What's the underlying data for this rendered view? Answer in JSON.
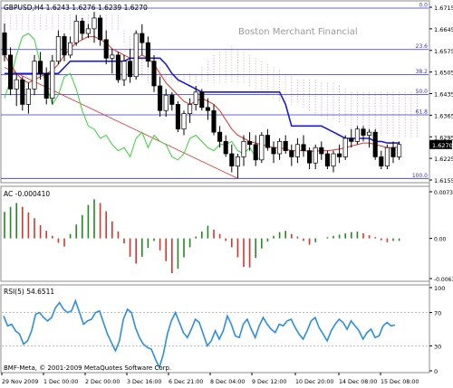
{
  "chart_data": [
    {
      "type": "candlestick",
      "title": "GBPUSD,H4  1.6243 1.6276 1.6239 1.6270",
      "watermark": "Boston Merchant Financial",
      "ylim": [
        1.6155,
        1.6715
      ],
      "y_ticks": [
        "1.6715",
        "1.6645",
        "1.6575",
        "1.6505",
        "1.6435",
        "1.6365",
        "1.6295",
        "1.6225",
        "1.6155"
      ],
      "last_price": "1.6270",
      "fib_levels": [
        {
          "label": "0.0",
          "value": 1.6712
        },
        {
          "label": "23.6",
          "value": 1.6578
        },
        {
          "label": "38.2",
          "value": 1.6497
        },
        {
          "label": "50.0",
          "value": 1.6432
        },
        {
          "label": "61.8",
          "value": 1.6366
        },
        {
          "label": "100.0",
          "value": 1.616
        }
      ],
      "colors": {
        "bull": "#ffffff",
        "bear": "#000000",
        "tenkan": "#e0302a",
        "kijun": "#1a1ad8",
        "chikou": "#37d437",
        "cloud": "#c8a0c8",
        "cloud_bull": "#e8b090",
        "fib": "#3333cc",
        "trend": "#e0302a",
        "frame": "#8c8c8c"
      },
      "candles": [
        {
          "o": 1.6632,
          "h": 1.6662,
          "l": 1.654,
          "c": 1.656
        },
        {
          "o": 1.656,
          "h": 1.6585,
          "l": 1.643,
          "c": 1.645
        },
        {
          "o": 1.645,
          "h": 1.65,
          "l": 1.6395,
          "c": 1.648
        },
        {
          "o": 1.648,
          "h": 1.649,
          "l": 1.638,
          "c": 1.64
        },
        {
          "o": 1.64,
          "h": 1.647,
          "l": 1.637,
          "c": 1.645
        },
        {
          "o": 1.645,
          "h": 1.656,
          "l": 1.643,
          "c": 1.654
        },
        {
          "o": 1.654,
          "h": 1.657,
          "l": 1.648,
          "c": 1.65
        },
        {
          "o": 1.65,
          "h": 1.652,
          "l": 1.64,
          "c": 1.642
        },
        {
          "o": 1.642,
          "h": 1.656,
          "l": 1.64,
          "c": 1.654
        },
        {
          "o": 1.654,
          "h": 1.664,
          "l": 1.653,
          "c": 1.662
        },
        {
          "o": 1.662,
          "h": 1.663,
          "l": 1.654,
          "c": 1.656
        },
        {
          "o": 1.656,
          "h": 1.662,
          "l": 1.655,
          "c": 1.66
        },
        {
          "o": 1.66,
          "h": 1.669,
          "l": 1.659,
          "c": 1.667
        },
        {
          "o": 1.667,
          "h": 1.668,
          "l": 1.661,
          "c": 1.663
        },
        {
          "o": 1.663,
          "h": 1.666,
          "l": 1.6615,
          "c": 1.6645
        },
        {
          "o": 1.6645,
          "h": 1.67,
          "l": 1.66,
          "c": 1.668
        },
        {
          "o": 1.668,
          "h": 1.669,
          "l": 1.659,
          "c": 1.661
        },
        {
          "o": 1.661,
          "h": 1.664,
          "l": 1.653,
          "c": 1.655
        },
        {
          "o": 1.655,
          "h": 1.658,
          "l": 1.65,
          "c": 1.656
        },
        {
          "o": 1.656,
          "h": 1.657,
          "l": 1.647,
          "c": 1.648
        },
        {
          "o": 1.648,
          "h": 1.656,
          "l": 1.646,
          "c": 1.654
        },
        {
          "o": 1.654,
          "h": 1.658,
          "l": 1.647,
          "c": 1.649
        },
        {
          "o": 1.649,
          "h": 1.664,
          "l": 1.648,
          "c": 1.663
        },
        {
          "o": 1.663,
          "h": 1.666,
          "l": 1.656,
          "c": 1.66
        },
        {
          "o": 1.66,
          "h": 1.662,
          "l": 1.652,
          "c": 1.654
        },
        {
          "o": 1.654,
          "h": 1.656,
          "l": 1.644,
          "c": 1.646
        },
        {
          "o": 1.646,
          "h": 1.649,
          "l": 1.636,
          "c": 1.638
        },
        {
          "o": 1.638,
          "h": 1.645,
          "l": 1.636,
          "c": 1.643
        },
        {
          "o": 1.643,
          "h": 1.644,
          "l": 1.638,
          "c": 1.64
        },
        {
          "o": 1.64,
          "h": 1.641,
          "l": 1.631,
          "c": 1.632
        },
        {
          "o": 1.632,
          "h": 1.638,
          "l": 1.63,
          "c": 1.637
        },
        {
          "o": 1.637,
          "h": 1.642,
          "l": 1.634,
          "c": 1.64
        },
        {
          "o": 1.64,
          "h": 1.646,
          "l": 1.638,
          "c": 1.644
        },
        {
          "o": 1.644,
          "h": 1.645,
          "l": 1.638,
          "c": 1.639
        },
        {
          "o": 1.639,
          "h": 1.642,
          "l": 1.635,
          "c": 1.638
        },
        {
          "o": 1.638,
          "h": 1.64,
          "l": 1.63,
          "c": 1.631
        },
        {
          "o": 1.631,
          "h": 1.633,
          "l": 1.626,
          "c": 1.628
        },
        {
          "o": 1.628,
          "h": 1.63,
          "l": 1.623,
          "c": 1.624
        },
        {
          "o": 1.624,
          "h": 1.627,
          "l": 1.618,
          "c": 1.62
        },
        {
          "o": 1.62,
          "h": 1.624,
          "l": 1.616,
          "c": 1.623
        },
        {
          "o": 1.623,
          "h": 1.63,
          "l": 1.62,
          "c": 1.628
        },
        {
          "o": 1.628,
          "h": 1.631,
          "l": 1.625,
          "c": 1.627
        },
        {
          "o": 1.627,
          "h": 1.63,
          "l": 1.62,
          "c": 1.622
        },
        {
          "o": 1.622,
          "h": 1.631,
          "l": 1.621,
          "c": 1.63
        },
        {
          "o": 1.63,
          "h": 1.632,
          "l": 1.625,
          "c": 1.626
        },
        {
          "o": 1.626,
          "h": 1.628,
          "l": 1.621,
          "c": 1.624
        },
        {
          "o": 1.624,
          "h": 1.629,
          "l": 1.622,
          "c": 1.628
        },
        {
          "o": 1.628,
          "h": 1.63,
          "l": 1.624,
          "c": 1.625
        },
        {
          "o": 1.625,
          "h": 1.627,
          "l": 1.62,
          "c": 1.623
        },
        {
          "o": 1.623,
          "h": 1.629,
          "l": 1.621,
          "c": 1.627
        },
        {
          "o": 1.627,
          "h": 1.63,
          "l": 1.623,
          "c": 1.625
        },
        {
          "o": 1.625,
          "h": 1.626,
          "l": 1.619,
          "c": 1.621
        },
        {
          "o": 1.621,
          "h": 1.627,
          "l": 1.619,
          "c": 1.626
        },
        {
          "o": 1.626,
          "h": 1.628,
          "l": 1.622,
          "c": 1.624
        },
        {
          "o": 1.624,
          "h": 1.625,
          "l": 1.619,
          "c": 1.62
        },
        {
          "o": 1.62,
          "h": 1.625,
          "l": 1.618,
          "c": 1.624
        },
        {
          "o": 1.624,
          "h": 1.627,
          "l": 1.621,
          "c": 1.623
        },
        {
          "o": 1.623,
          "h": 1.63,
          "l": 1.622,
          "c": 1.629
        },
        {
          "o": 1.629,
          "h": 1.632,
          "l": 1.626,
          "c": 1.628
        },
        {
          "o": 1.628,
          "h": 1.633,
          "l": 1.627,
          "c": 1.632
        },
        {
          "o": 1.632,
          "h": 1.633,
          "l": 1.628,
          "c": 1.63
        },
        {
          "o": 1.63,
          "h": 1.632,
          "l": 1.626,
          "c": 1.631
        },
        {
          "o": 1.631,
          "h": 1.632,
          "l": 1.622,
          "c": 1.623
        },
        {
          "o": 1.623,
          "h": 1.625,
          "l": 1.619,
          "c": 1.62
        },
        {
          "o": 1.62,
          "h": 1.627,
          "l": 1.619,
          "c": 1.626
        },
        {
          "o": 1.626,
          "h": 1.628,
          "l": 1.621,
          "c": 1.623
        },
        {
          "o": 1.623,
          "h": 1.628,
          "l": 1.622,
          "c": 1.627
        }
      ],
      "tenkan": [
        1.656,
        1.653,
        1.65,
        1.648,
        1.647,
        1.648,
        1.649,
        1.65,
        1.651,
        1.653,
        1.656,
        1.658,
        1.66,
        1.661,
        1.662,
        1.662,
        1.661,
        1.66,
        1.658,
        1.657,
        1.656,
        1.655,
        1.655,
        1.656,
        1.655,
        1.653,
        1.65,
        1.647,
        1.645,
        1.643,
        1.641,
        1.64,
        1.641,
        1.642,
        1.641,
        1.64,
        1.638,
        1.635,
        1.632,
        1.63,
        1.629,
        1.628,
        1.6275,
        1.627,
        1.6265,
        1.626,
        1.626,
        1.6255,
        1.625,
        1.625,
        1.625,
        1.6248,
        1.6248,
        1.625,
        1.625,
        1.6252,
        1.6255,
        1.626,
        1.6265,
        1.627,
        1.6275,
        1.6275,
        1.627,
        1.6265,
        1.626,
        1.626,
        1.6262
      ],
      "kijun": [
        1.65,
        1.65,
        1.65,
        1.65,
        1.65,
        1.65,
        1.65,
        1.65,
        1.65,
        1.65,
        1.652,
        1.654,
        1.654,
        1.654,
        1.654,
        1.654,
        1.654,
        1.654,
        1.654,
        1.654,
        1.654,
        1.655,
        1.655,
        1.655,
        1.655,
        1.655,
        1.655,
        1.653,
        1.65,
        1.648,
        1.647,
        1.646,
        1.645,
        1.644,
        1.644,
        1.644,
        1.644,
        1.644,
        1.644,
        1.644,
        1.644,
        1.644,
        1.644,
        1.644,
        1.644,
        1.644,
        1.644,
        1.64,
        1.633,
        1.633,
        1.633,
        1.633,
        1.633,
        1.633,
        1.632,
        1.631,
        1.63,
        1.629,
        1.629,
        1.629,
        1.629,
        1.629,
        1.628,
        1.628,
        1.6275,
        1.6275,
        1.6275
      ],
      "chikou": [
        1.642,
        1.648,
        1.656,
        1.662,
        1.663,
        1.661,
        1.653,
        1.646,
        1.64,
        1.643,
        1.649,
        1.65,
        1.645,
        1.638,
        1.633,
        1.632,
        1.629,
        1.63,
        1.627,
        1.625,
        1.626,
        1.623,
        1.629,
        1.631,
        1.626,
        1.63,
        1.628,
        1.627,
        1.623,
        1.622,
        1.624,
        1.629,
        1.63,
        1.628,
        1.626,
        1.625,
        1.627,
        1.627,
        1.628,
        1.625,
        1.624,
        1.626,
        1.623,
        1.622
      ]
    },
    {
      "type": "bar",
      "title": "AC -0.000410",
      "y_ticks": [
        "0.007390",
        "0.00",
        "-0.006360"
      ],
      "ylim": [
        -0.00636,
        0.00739
      ],
      "values": [
        0.0042,
        0.005,
        0.0056,
        0.005,
        0.0041,
        0.0032,
        0.0021,
        0.0012,
        0.0004,
        -0.0007,
        -0.0013,
        0.0007,
        0.0022,
        0.0037,
        0.0053,
        0.0062,
        0.0056,
        0.0043,
        0.0027,
        0.0011,
        -0.0008,
        -0.0029,
        -0.004,
        -0.0029,
        -0.0015,
        -0.0004,
        -0.0019,
        -0.0036,
        -0.0055,
        -0.0048,
        -0.003,
        -0.0014,
        0.0003,
        0.0011,
        0.002,
        0.0014,
        0.0007,
        -0.0004,
        -0.0014,
        -0.003,
        -0.0045,
        -0.0046,
        -0.0031,
        -0.0016,
        -0.0005,
        0.0004,
        0.001,
        0.0012,
        0.0007,
        0.0003,
        -0.0004,
        -0.001,
        -0.0006,
        0.0,
        0.0002,
        0.0004,
        0.0006,
        0.0008,
        0.001,
        0.0011,
        0.0008,
        0.0005,
        0.0002,
        -0.0003,
        -0.0006,
        -0.0004,
        -0.0004
      ],
      "colors": {
        "up": "#1f8c1f",
        "down": "#e0302a"
      }
    },
    {
      "type": "line",
      "title": "RSI(5) 54.6511",
      "y_ticks": [
        "100",
        "70",
        "30",
        "0"
      ],
      "ylim": [
        0,
        100
      ],
      "levels": [
        70,
        30
      ],
      "values": [
        66,
        54,
        56,
        48,
        44,
        32,
        36,
        48,
        68,
        70,
        64,
        60,
        64,
        76,
        82,
        74,
        70,
        72,
        84,
        70,
        56,
        60,
        62,
        70,
        72,
        58,
        44,
        34,
        24,
        36,
        62,
        74,
        70,
        52,
        40,
        32,
        28,
        26,
        14,
        4,
        20,
        44,
        60,
        70,
        58,
        46,
        40,
        50,
        62,
        58,
        44,
        30,
        36,
        48,
        38,
        48,
        66,
        56,
        42,
        40,
        56,
        62,
        50,
        40,
        54,
        64,
        56,
        50,
        46,
        56,
        54,
        60,
        62,
        52,
        44,
        38,
        48,
        60,
        64,
        52,
        44,
        36,
        48,
        56,
        62,
        58,
        50,
        60,
        54,
        48,
        38,
        46,
        50,
        40,
        42,
        54,
        58,
        54,
        55
      ],
      "color": "#2b8ee6"
    }
  ],
  "time_axis": [
    "29 Nov 2009",
    "1 Dec 00:00",
    "2 Dec 00:00",
    "3 Dec 16:00",
    "6 Dec 21:00",
    "8 Dec 04:00",
    "9 Dec 12:00",
    "10 Dec 20:00",
    "14 Dec 08:00",
    "15 Dec 08:00"
  ],
  "copyright": "BMF-Meta, © 2001-2009 MetaQuotes Software Corp."
}
